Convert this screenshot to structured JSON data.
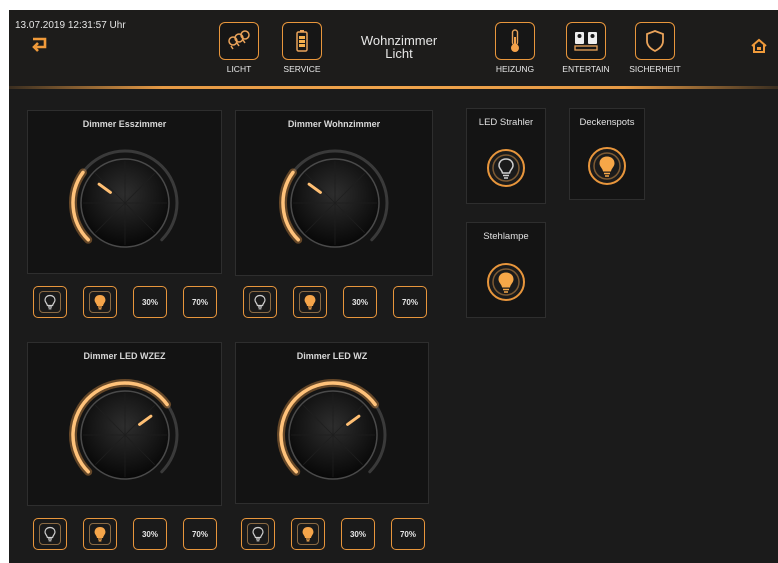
{
  "header": {
    "datetime": "13.07.2019 12:31:57 Uhr",
    "room_line1": "Wohnzimmer",
    "room_line2": "Licht",
    "nav": [
      {
        "label": "LICHT",
        "icon": "bulbs-icon"
      },
      {
        "label": "SERVICE",
        "icon": "battery-icon"
      },
      {
        "label": "HEIZUNG",
        "icon": "thermometer-icon"
      },
      {
        "label": "ENTERTAIN",
        "icon": "media-icon"
      },
      {
        "label": "SICHERHEIT",
        "icon": "shield-icon"
      }
    ]
  },
  "dimmers": [
    {
      "title": "Dimmer Esszimmer",
      "level": 0.3,
      "buttons": [
        "",
        "",
        "30%",
        "70%"
      ]
    },
    {
      "title": "Dimmer Wohnzimmer",
      "level": 0.3,
      "buttons": [
        "",
        "",
        "30%",
        "70%"
      ]
    },
    {
      "title": "Dimmer LED WZEZ",
      "level": 0.7,
      "buttons": [
        "",
        "",
        "30%",
        "70%"
      ]
    },
    {
      "title": "Dimmer LED WZ",
      "level": 0.7,
      "buttons": [
        "",
        "",
        "30%",
        "70%"
      ]
    }
  ],
  "tiles": [
    {
      "title": "LED Strahler",
      "state": "off"
    },
    {
      "title": "Deckenspots",
      "state": "on"
    },
    {
      "title": "Stehlampe",
      "state": "on"
    }
  ],
  "colors": {
    "accent": "#e8963c",
    "background": "#1b1b1b",
    "panel": "#131313"
  }
}
